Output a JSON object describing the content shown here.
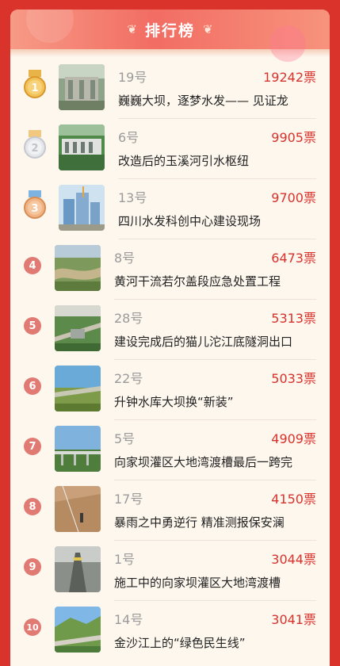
{
  "header": {
    "title": "排行榜"
  },
  "colors": {
    "brand_red": "#d9332c",
    "vote_red": "#d8322c",
    "rank_circle": "#e17a72"
  },
  "items": [
    {
      "rank": "1",
      "number": "19号",
      "votes": "19242票",
      "title": "巍巍大坝，逐梦水发—— 见证龙",
      "medal": "gold-medal-icon"
    },
    {
      "rank": "2",
      "number": "6号",
      "votes": "9905票",
      "title": "改造后的玉溪河引水枢纽",
      "medal": "silver-medal-icon"
    },
    {
      "rank": "3",
      "number": "13号",
      "votes": "9700票",
      "title": "四川水发科创中心建设现场",
      "medal": "bronze-medal-icon"
    },
    {
      "rank": "4",
      "number": "8号",
      "votes": "6473票",
      "title": "黄河干流若尔盖段应急处置工程"
    },
    {
      "rank": "5",
      "number": "28号",
      "votes": "5313票",
      "title": "建设完成后的猫儿沱江底隧洞出口"
    },
    {
      "rank": "6",
      "number": "22号",
      "votes": "5033票",
      "title": "升钟水库大坝换“新装”"
    },
    {
      "rank": "7",
      "number": "5号",
      "votes": "4909票",
      "title": "向家坝灌区大地湾渡槽最后一跨完"
    },
    {
      "rank": "8",
      "number": "17号",
      "votes": "4150票",
      "title": "暴雨之中勇逆行 精准测报保安澜"
    },
    {
      "rank": "9",
      "number": "1号",
      "votes": "3044票",
      "title": "施工中的向家坝灌区大地湾渡槽"
    },
    {
      "rank": "10",
      "number": "14号",
      "votes": "3041票",
      "title": "金沙江上的“绿色民生线”"
    }
  ]
}
